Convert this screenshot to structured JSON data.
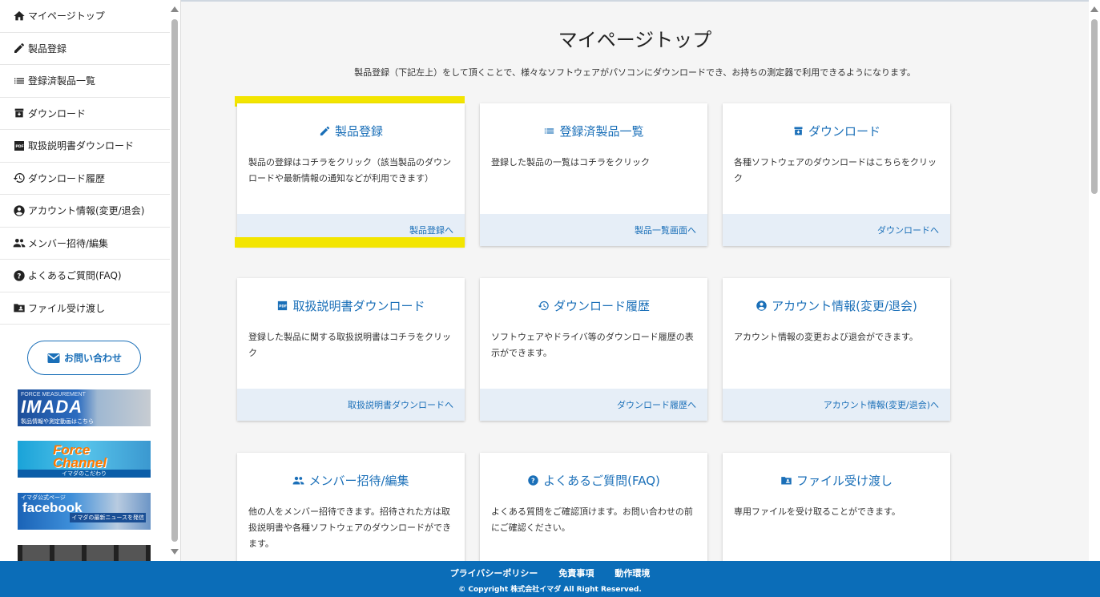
{
  "sidebar": {
    "items": [
      {
        "label": "マイページトップ",
        "icon": "home-icon"
      },
      {
        "label": "製品登録",
        "icon": "pencil-icon"
      },
      {
        "label": "登録済製品一覧",
        "icon": "list-icon"
      },
      {
        "label": "ダウンロード",
        "icon": "archive-icon"
      },
      {
        "label": "取扱説明書ダウンロード",
        "icon": "pdf-icon"
      },
      {
        "label": "ダウンロード履歴",
        "icon": "history-icon"
      },
      {
        "label": "アカウント情報(変更/退会)",
        "icon": "account-circle-icon"
      },
      {
        "label": "メンバー招待/編集",
        "icon": "group-icon"
      },
      {
        "label": "よくあるご質問(FAQ)",
        "icon": "help-icon"
      },
      {
        "label": "ファイル受け渡し",
        "icon": "folder-shared-icon"
      }
    ],
    "contact_label": "お問い合わせ",
    "banners": {
      "imada_top": "FORCE MEASUREMENT",
      "imada_main": "IMADA",
      "imada_sub": "製品情報や測定動画はこちら",
      "force_line1": "Force",
      "force_line2": "Channel",
      "force_sub": "イマダのこだわり",
      "fb_top": "イマダ公式ページ",
      "fb_main": "facebook",
      "fb_sub": "イマダの最新ニュースを発信"
    }
  },
  "main": {
    "title": "マイページトップ",
    "description": "製品登録（下記左上）をして頂くことで、様々なソフトウェアがパソコンにダウンロードでき、お持ちの測定器で利用できるようになります。",
    "cards": [
      {
        "title": "製品登録",
        "icon": "pencil-icon",
        "body": "製品の登録はコチラをクリック（該当製品のダウンロードや最新情報の通知などが利用できます）",
        "link": "製品登録へ"
      },
      {
        "title": "登録済製品一覧",
        "icon": "list-icon",
        "body": "登録した製品の一覧はコチラをクリック",
        "link": "製品一覧画面へ"
      },
      {
        "title": "ダウンロード",
        "icon": "archive-icon",
        "body": "各種ソフトウェアのダウンロードはこちらをクリック",
        "link": "ダウンロードへ"
      },
      {
        "title": "取扱説明書ダウンロード",
        "icon": "pdf-icon",
        "body": "登録した製品に関する取扱説明書はコチラをクリック",
        "link": "取扱説明書ダウンロードへ"
      },
      {
        "title": "ダウンロード履歴",
        "icon": "history-icon",
        "body": "ソフトウェアやドライバ等のダウンロード履歴の表示ができます。",
        "link": "ダウンロード履歴へ"
      },
      {
        "title": "アカウント情報(変更/退会)",
        "icon": "account-circle-icon",
        "body": "アカウント情報の変更および退会ができます。",
        "link": "アカウント情報(変更/退会)へ"
      },
      {
        "title": "メンバー招待/編集",
        "icon": "group-icon",
        "body": "他の人をメンバー招待できます。招待された方は取扱説明書や各種ソフトウェアのダウンロードができます。",
        "link": ""
      },
      {
        "title": "よくあるご質問(FAQ)",
        "icon": "help-icon",
        "body": "よくある質問をご確認頂けます。お問い合わせの前にご確認ください。",
        "link": ""
      },
      {
        "title": "ファイル受け渡し",
        "icon": "folder-shared-icon",
        "body": "専用ファイルを受け取ることができます。",
        "link": ""
      }
    ]
  },
  "footer": {
    "links": [
      "プライバシーポリシー",
      "免責事項",
      "動作環境"
    ],
    "copyright": "© Copyright  株式会社イマダ  All Right Reserved."
  },
  "colors": {
    "accent": "#1a6fb8",
    "footer_bg": "#0b6db8",
    "highlight": "#f3e500",
    "card_foot_bg": "#e6eef7"
  }
}
